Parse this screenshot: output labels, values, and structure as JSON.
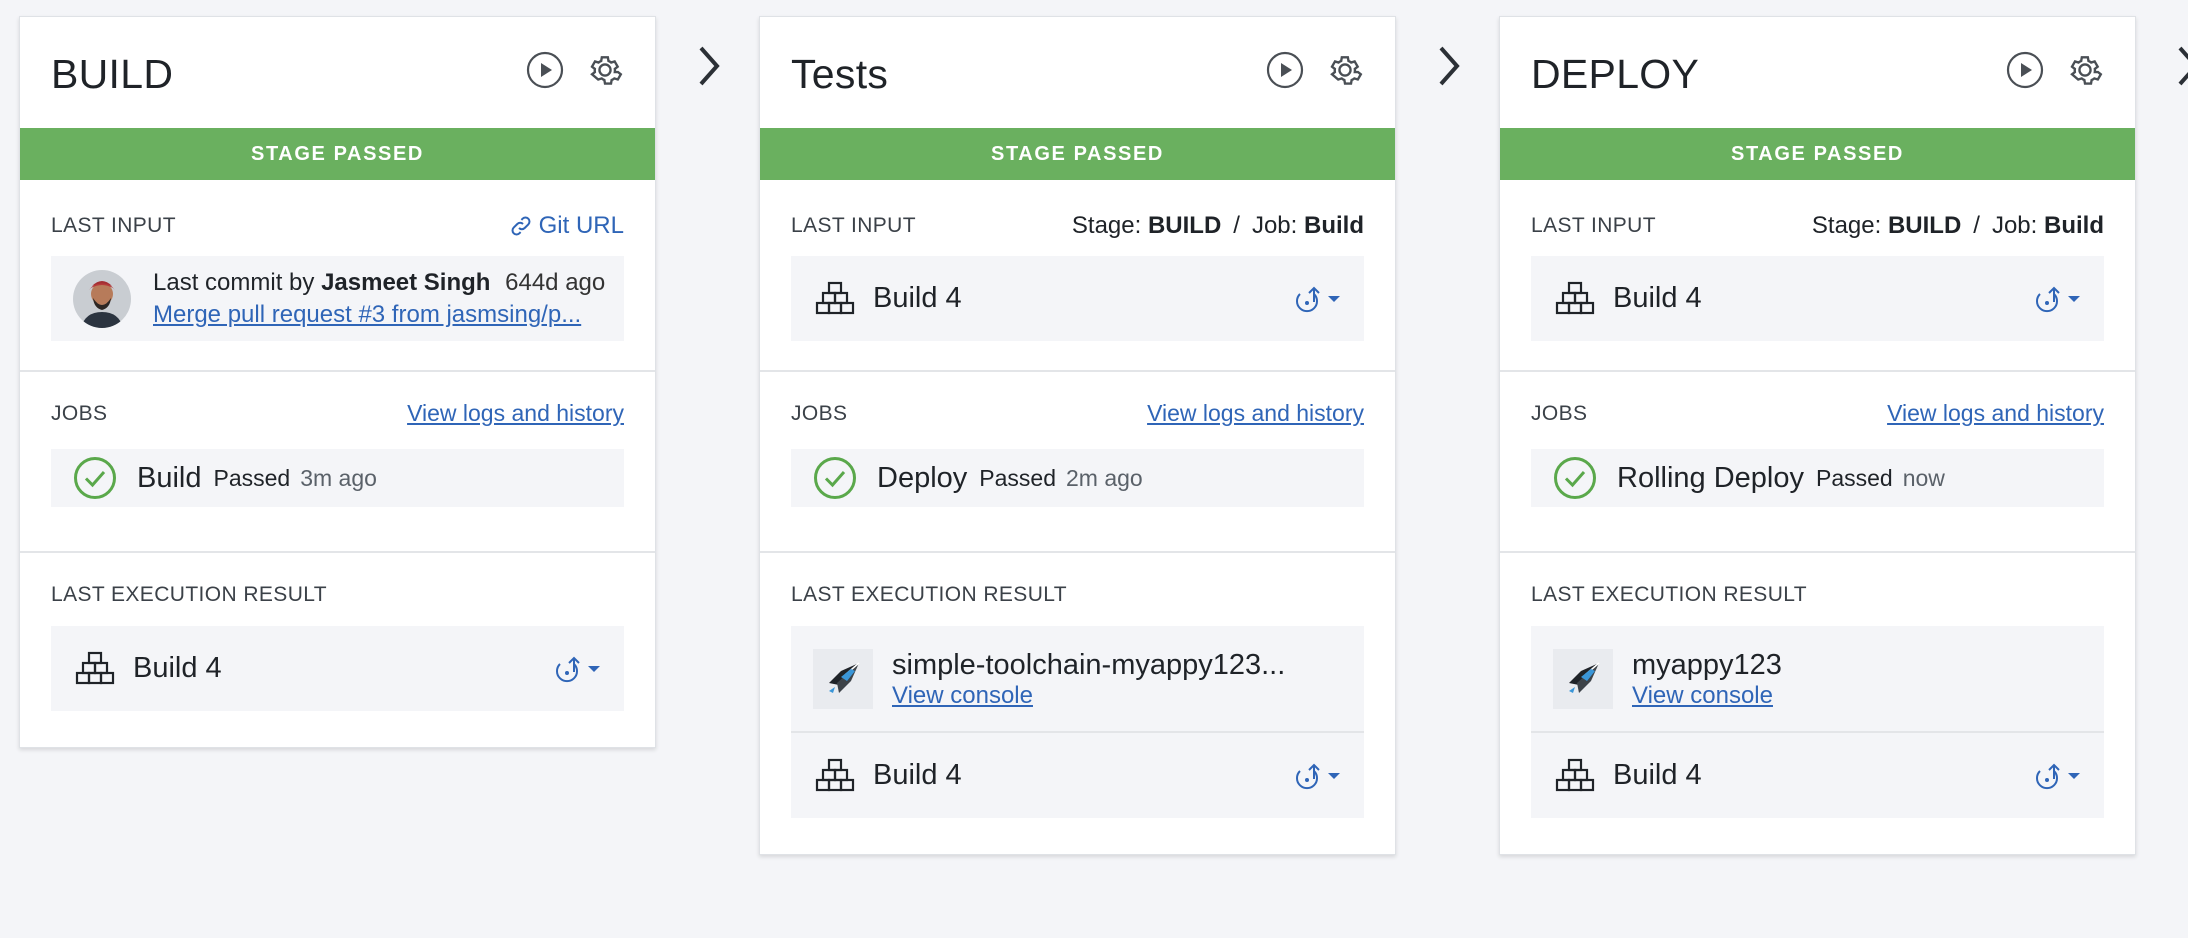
{
  "stages": [
    {
      "title": "BUILD",
      "status": "STAGE PASSED",
      "last_input": {
        "label": "LAST INPUT",
        "link_label": "Git URL",
        "commit_prefix": "Last commit by",
        "author": "Jasmeet Singh",
        "ago": "644d ago",
        "message": "Merge pull request #3 from jasmsing/p..."
      },
      "jobs": {
        "label": "JOBS",
        "link": "View logs and history",
        "name": "Build",
        "status": "Passed",
        "time": "3m ago"
      },
      "last_execution": {
        "label": "LAST EXECUTION RESULT",
        "build": "Build 4"
      }
    },
    {
      "title": "Tests",
      "status": "STAGE PASSED",
      "last_input": {
        "label": "LAST INPUT",
        "stage_prefix": "Stage:",
        "stage_name": "BUILD",
        "sep": "/",
        "job_prefix": "Job:",
        "job_name": "Build",
        "build": "Build 4"
      },
      "jobs": {
        "label": "JOBS",
        "link": "View logs and history",
        "name": "Deploy",
        "status": "Passed",
        "time": "2m ago"
      },
      "last_execution": {
        "label": "LAST EXECUTION RESULT",
        "deploy_name": "simple-toolchain-myappy123...",
        "console": "View console",
        "build": "Build 4"
      }
    },
    {
      "title": "DEPLOY",
      "status": "STAGE PASSED",
      "last_input": {
        "label": "LAST INPUT",
        "stage_prefix": "Stage:",
        "stage_name": "BUILD",
        "sep": "/",
        "job_prefix": "Job:",
        "job_name": "Build",
        "build": "Build 4"
      },
      "jobs": {
        "label": "JOBS",
        "link": "View logs and history",
        "name": "Rolling Deploy",
        "status": "Passed",
        "time": "now"
      },
      "last_execution": {
        "label": "LAST EXECUTION RESULT",
        "deploy_name": "myappy123",
        "console": "View console",
        "build": "Build 4"
      }
    }
  ],
  "colors": {
    "passed": "#6ab05f",
    "link": "#2f65b7",
    "background": "#f4f5f8"
  },
  "icons": [
    "play-icon",
    "gear-icon",
    "link-icon",
    "build-blocks-icon",
    "redeploy-icon",
    "check-circle-icon",
    "rocket-icon",
    "chevron-right-icon",
    "avatar"
  ]
}
